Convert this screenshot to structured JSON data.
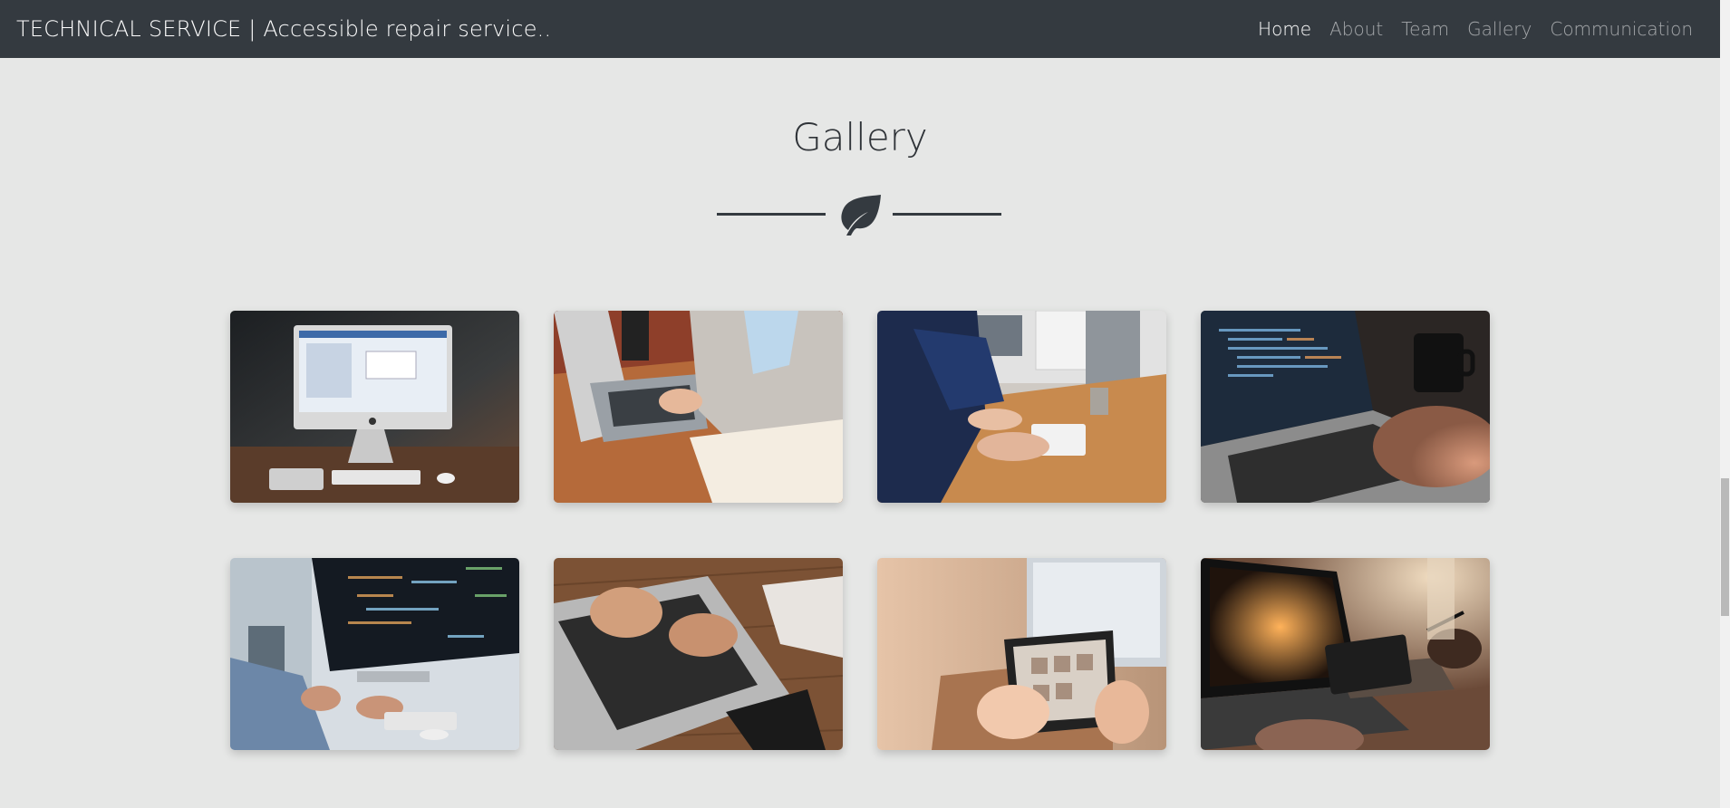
{
  "navbar": {
    "brand": "TECHNICAL SERVICE | Accessible repair service..",
    "links": [
      {
        "label": "Home",
        "active": true
      },
      {
        "label": "About",
        "active": false
      },
      {
        "label": "Team",
        "active": false
      },
      {
        "label": "Gallery",
        "active": false
      },
      {
        "label": "Communication",
        "active": false
      }
    ]
  },
  "gallery": {
    "title": "Gallery",
    "divider_icon": "leaf-icon",
    "images": [
      {
        "name": "desktop-computer-on-desk"
      },
      {
        "name": "person-typing-on-laptop"
      },
      {
        "name": "people-working-at-computers"
      },
      {
        "name": "laptop-with-code-and-mug"
      },
      {
        "name": "developer-at-desktop-code"
      },
      {
        "name": "hands-on-laptop-keyboard"
      },
      {
        "name": "hands-using-tablet"
      },
      {
        "name": "laptop-with-drawing-tablet"
      }
    ]
  },
  "colors": {
    "navbar_bg": "#343a40",
    "page_bg": "#e6e7e6",
    "title_text": "#2f3338",
    "nav_active": "#ffffff",
    "nav_inactive": "rgba(255,255,255,0.55)"
  }
}
